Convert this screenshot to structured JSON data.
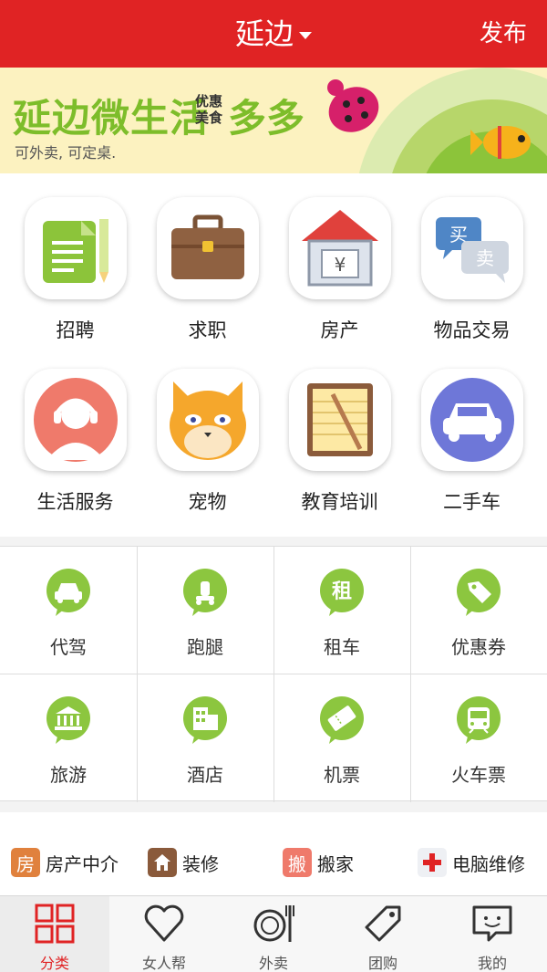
{
  "header": {
    "city": "延边",
    "publish_label": "发布"
  },
  "banner": {
    "title": "延边微生活",
    "small_lines": [
      "优惠",
      "美食"
    ],
    "big": "多多",
    "subtitle": "可外卖, 可定桌."
  },
  "categories": [
    {
      "label": "招聘",
      "icon": "document-pencil-icon"
    },
    {
      "label": "求职",
      "icon": "briefcase-icon"
    },
    {
      "label": "房产",
      "icon": "house-icon",
      "icon_text": "¥"
    },
    {
      "label": "物品交易",
      "icon": "buy-sell-chat-icon",
      "icon_text_1": "买",
      "icon_text_2": "卖"
    },
    {
      "label": "生活服务",
      "icon": "headset-agent-icon"
    },
    {
      "label": "宠物",
      "icon": "cat-face-icon"
    },
    {
      "label": "教育培训",
      "icon": "notepad-pen-icon"
    },
    {
      "label": "二手车",
      "icon": "car-icon"
    }
  ],
  "services": [
    {
      "label": "代驾",
      "icon": "car-icon"
    },
    {
      "label": "跑腿",
      "icon": "scooter-icon"
    },
    {
      "label": "租车",
      "icon": "rent-icon",
      "icon_text": "租"
    },
    {
      "label": "优惠券",
      "icon": "tag-icon"
    },
    {
      "label": "旅游",
      "icon": "landmark-icon"
    },
    {
      "label": "酒店",
      "icon": "hotel-icon"
    },
    {
      "label": "机票",
      "icon": "ticket-icon"
    },
    {
      "label": "火车票",
      "icon": "train-icon"
    }
  ],
  "quick_links": [
    {
      "label": "房产中介",
      "badge": "房",
      "color": "#e0813d"
    },
    {
      "label": "装修",
      "badge": "",
      "color": "#8a5a3b"
    },
    {
      "label": "搬家",
      "badge": "搬",
      "color": "#ef7a6b"
    },
    {
      "label": "电脑维修",
      "badge": "",
      "color": "#e02324"
    }
  ],
  "tabs": [
    {
      "label": "分类",
      "icon": "grid-icon",
      "active": true
    },
    {
      "label": "女人帮",
      "icon": "heart-icon",
      "active": false
    },
    {
      "label": "外卖",
      "icon": "plate-fork-icon",
      "active": false
    },
    {
      "label": "团购",
      "icon": "tag-icon",
      "active": false
    },
    {
      "label": "我的",
      "icon": "chat-smile-icon",
      "active": false
    }
  ],
  "colors": {
    "brand_red": "#e02324",
    "service_green": "#8cc63f",
    "banner_green": "#7dbd2a"
  }
}
